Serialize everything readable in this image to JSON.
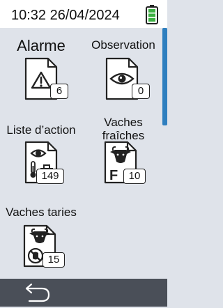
{
  "status_bar": {
    "time": "10:32 26/04/2024",
    "battery_color": "#3cb043"
  },
  "tiles": [
    {
      "label": "Alarme",
      "icon": "warning-icon",
      "count": "6"
    },
    {
      "label": "Observation",
      "icon": "eye-icon",
      "count": "0"
    },
    {
      "label": "Liste d’action",
      "icon": "action-list-icon",
      "count": "149"
    },
    {
      "label": "Vaches fraîches",
      "label_line1": "Vaches",
      "label_line2": "fraîches",
      "icon": "cow-fresh-icon",
      "count": "10"
    },
    {
      "label": "Vaches taries",
      "icon": "cow-dry-icon",
      "count": "15"
    }
  ],
  "bottom_bar": {
    "back_icon": "back-arrow-icon"
  },
  "colors": {
    "background": "#dfe3ea",
    "scrollbar": "#2f7fbf",
    "bottom_bar": "#4a4f58"
  }
}
